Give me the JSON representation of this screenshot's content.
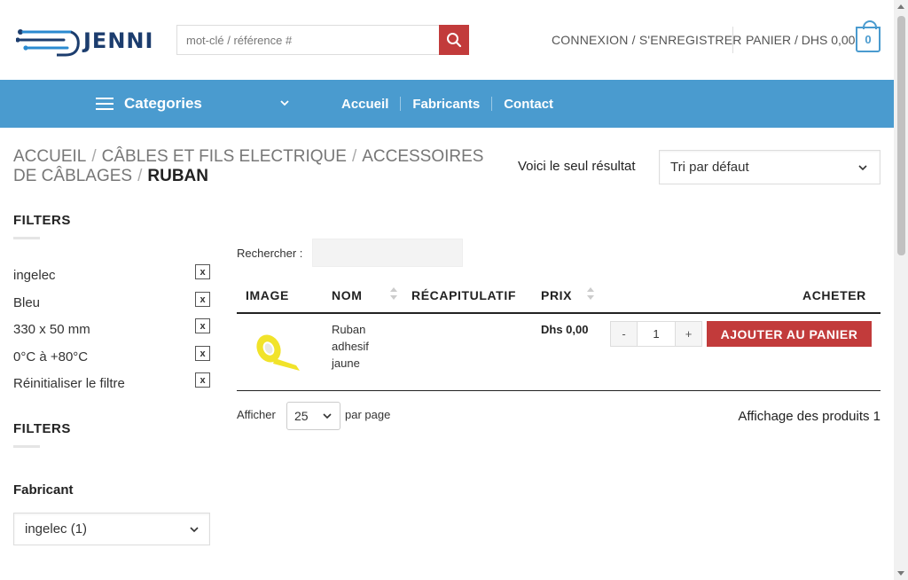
{
  "header": {
    "logo_text": "JENNI",
    "search_placeholder": "mot-clé / référence #",
    "login_label": "CONNEXION / S'ENREGISTRER",
    "cart_label": "PANIER / DHS 0,00",
    "cart_count": "0"
  },
  "nav": {
    "categories_label": "Categories",
    "items": [
      "Accueil",
      "Fabricants",
      "Contact"
    ]
  },
  "breadcrumb": {
    "items": [
      "ACCUEIL",
      "CÂBLES ET FILS ELECTRIQUE",
      "ACCESSOIRES DE CÂBLAGES"
    ],
    "current": "RUBAN"
  },
  "toolbar": {
    "result_text": "Voici le seul résultat",
    "sort_selected": "Tri par défaut"
  },
  "sidebar": {
    "filters_title": "FILTERS",
    "active_filters": [
      "ingelec",
      "Bleu",
      "330 x 50 mm",
      "0°C à +80°C",
      "Réinitialiser le filtre"
    ],
    "remove_icon_text": "x",
    "filters_title_2": "FILTERS",
    "fabricant_label": "Fabricant",
    "fabricant_selected": "ingelec (1)"
  },
  "table": {
    "search_label": "Rechercher :",
    "headers": {
      "image": "IMAGE",
      "name": "NOM",
      "summary": "RÉCAPITULATIF",
      "price": "PRIX",
      "buy": "ACHETER"
    },
    "rows": [
      {
        "name": "Ruban adhesif jaune",
        "price": "Dhs 0,00",
        "qty_minus": "-",
        "qty": "1",
        "qty_plus": "+",
        "add_label": "AJOUTER AU PANIER"
      }
    ],
    "show_label": "Afficher",
    "show_selected": "25",
    "per_page_label": "par page",
    "showing_text": "Affichage des produits 1"
  },
  "colors": {
    "nav_blue": "#4a9bcf",
    "accent_red": "#c23b3b",
    "logo_navy": "#1c3d6e"
  }
}
